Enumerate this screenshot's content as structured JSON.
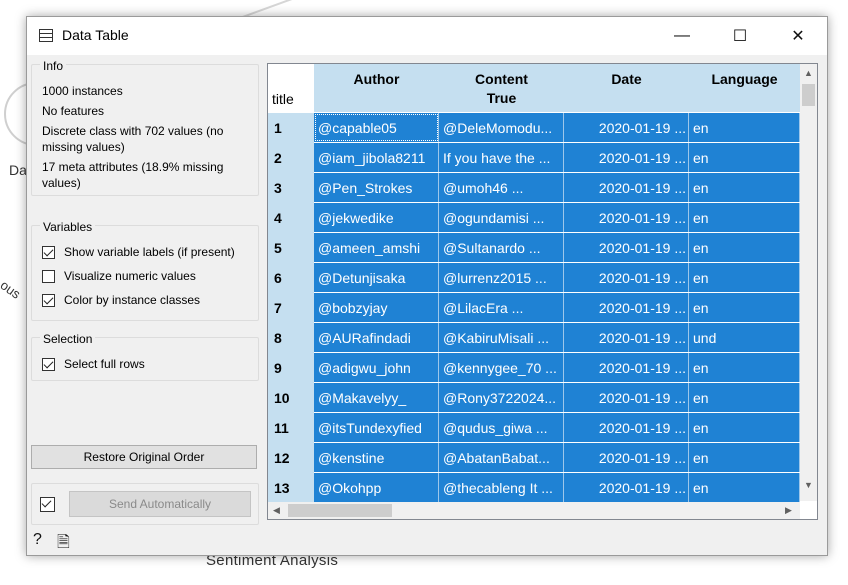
{
  "background": {
    "left_label": "Da",
    "bottom_label": "Sentiment Analysis",
    "side_label": "ous"
  },
  "window": {
    "title": "Data Table",
    "minimize": "—",
    "maximize": "☐",
    "close": "✕"
  },
  "info": {
    "title": "Info",
    "lines": [
      "1000 instances",
      "No features",
      "Discrete class with 702 values (no missing values)",
      "17 meta attributes (18.9% missing values)"
    ]
  },
  "variables": {
    "title": "Variables",
    "options": [
      {
        "label": "Show variable labels (if present)",
        "checked": true
      },
      {
        "label": "Visualize numeric values",
        "checked": false
      },
      {
        "label": "Color by instance classes",
        "checked": true
      }
    ]
  },
  "selection": {
    "title": "Selection",
    "options": [
      {
        "label": "Select full rows",
        "checked": true
      }
    ]
  },
  "buttons": {
    "restore": "Restore Original Order",
    "send": "Send Automatically",
    "auto_send_checked": true
  },
  "table": {
    "corner_label": "title",
    "headers": [
      {
        "name": "Author",
        "sub": ""
      },
      {
        "name": "Content",
        "sub": "True"
      },
      {
        "name": "Date",
        "sub": ""
      },
      {
        "name": "Language",
        "sub": ""
      }
    ],
    "rows": [
      {
        "num": "1",
        "author": "@capable05",
        "content": "@DeleMomodu...",
        "date": "2020-01-19 ...",
        "lang": "en"
      },
      {
        "num": "2",
        "author": "@iam_jibola8211",
        "content": "If you have the ...",
        "date": "2020-01-19 ...",
        "lang": "en"
      },
      {
        "num": "3",
        "author": "@Pen_Strokes",
        "content": "@umoh46 ...",
        "date": "2020-01-19 ...",
        "lang": "en"
      },
      {
        "num": "4",
        "author": "@jekwedike",
        "content": "@ogundamisi ...",
        "date": "2020-01-19 ...",
        "lang": "en"
      },
      {
        "num": "5",
        "author": "@ameen_amshi",
        "content": "@Sultanardo ...",
        "date": "2020-01-19 ...",
        "lang": "en"
      },
      {
        "num": "6",
        "author": "@Detunjisaka",
        "content": "@lurrenz2015 ...",
        "date": "2020-01-19 ...",
        "lang": "en"
      },
      {
        "num": "7",
        "author": "@bobzyjay",
        "content": "@LilacEra ...",
        "date": "2020-01-19 ...",
        "lang": "en"
      },
      {
        "num": "8",
        "author": "@AURafindadi",
        "content": "@KabiruMisali ...",
        "date": "2020-01-19 ...",
        "lang": "und"
      },
      {
        "num": "9",
        "author": "@adigwu_john",
        "content": "@kennygee_70 ...",
        "date": "2020-01-19 ...",
        "lang": "en"
      },
      {
        "num": "10",
        "author": "@Makavelyy_",
        "content": "@Rony3722024...",
        "date": "2020-01-19 ...",
        "lang": "en"
      },
      {
        "num": "11",
        "author": "@itsTundexyfied",
        "content": "@qudus_giwa ...",
        "date": "2020-01-19 ...",
        "lang": "en"
      },
      {
        "num": "12",
        "author": "@kenstine",
        "content": "@AbatanBabat...",
        "date": "2020-01-19 ...",
        "lang": "en"
      },
      {
        "num": "13",
        "author": "@Okohpp",
        "content": "@thecableng It ...",
        "date": "2020-01-19 ...",
        "lang": "en"
      }
    ]
  },
  "colors": {
    "row_fill": "#1f82d4",
    "header_fill": "#c5dff0"
  }
}
